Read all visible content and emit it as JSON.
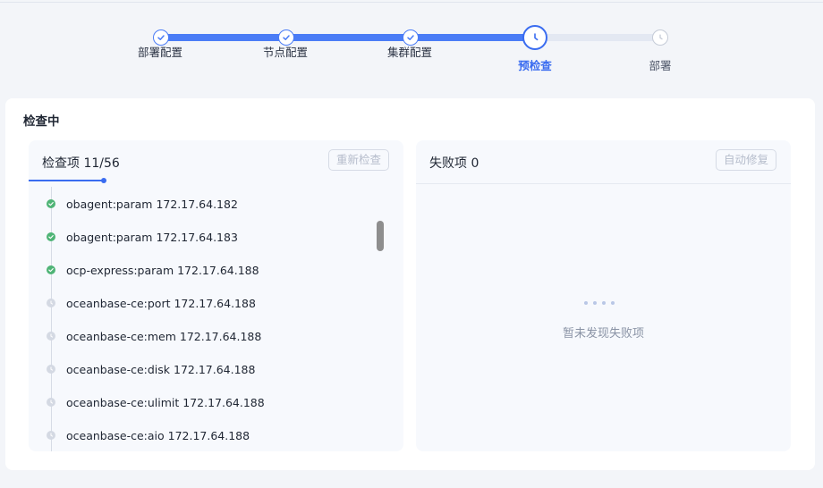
{
  "stepper": {
    "steps": [
      {
        "label": "部署配置",
        "state": "done"
      },
      {
        "label": "节点配置",
        "state": "done"
      },
      {
        "label": "集群配置",
        "state": "done"
      },
      {
        "label": "预检查",
        "state": "current"
      },
      {
        "label": "部署",
        "state": "pending"
      }
    ]
  },
  "card": {
    "title": "检查中"
  },
  "check_panel": {
    "title": "检查项 11/56",
    "recheck_button": "重新检查",
    "items": [
      {
        "text": "obagent:param 172.17.64.182",
        "status": "passed"
      },
      {
        "text": "obagent:param 172.17.64.183",
        "status": "passed"
      },
      {
        "text": "ocp-express:param 172.17.64.188",
        "status": "passed"
      },
      {
        "text": "oceanbase-ce:port 172.17.64.188",
        "status": "pending"
      },
      {
        "text": "oceanbase-ce:mem 172.17.64.188",
        "status": "pending"
      },
      {
        "text": "oceanbase-ce:disk 172.17.64.188",
        "status": "pending"
      },
      {
        "text": "oceanbase-ce:ulimit 172.17.64.188",
        "status": "pending"
      },
      {
        "text": "oceanbase-ce:aio 172.17.64.188",
        "status": "pending"
      }
    ]
  },
  "failed_panel": {
    "title": "失败项 0",
    "auto_fix_button": "自动修复",
    "empty_text": "暂未发现失败项"
  },
  "colors": {
    "accent": "#3a6cf0",
    "success": "#4fb476",
    "pending": "#d4d9e3"
  }
}
